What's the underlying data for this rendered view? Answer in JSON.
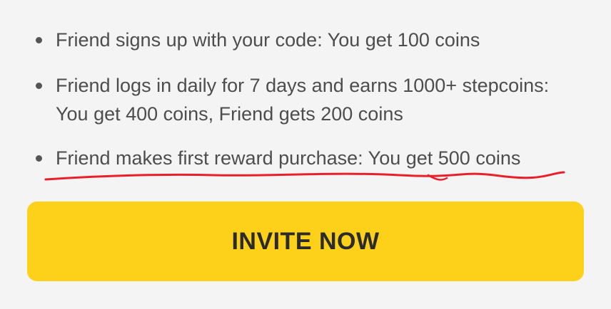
{
  "rewards": {
    "items": [
      {
        "text": "Friend signs up with your code: You get 100 coins"
      },
      {
        "text": "Friend logs in daily for 7 days and earns 1000+ stepcoins: You get 400 coins, Friend gets 200 coins"
      },
      {
        "text": "Friend makes first reward purchase: You get 500 coins"
      }
    ]
  },
  "invite": {
    "label": "INVITE NOW"
  },
  "colors": {
    "button": "#fdd01a",
    "annotation": "#e8202a",
    "text": "#4d4d4d"
  }
}
